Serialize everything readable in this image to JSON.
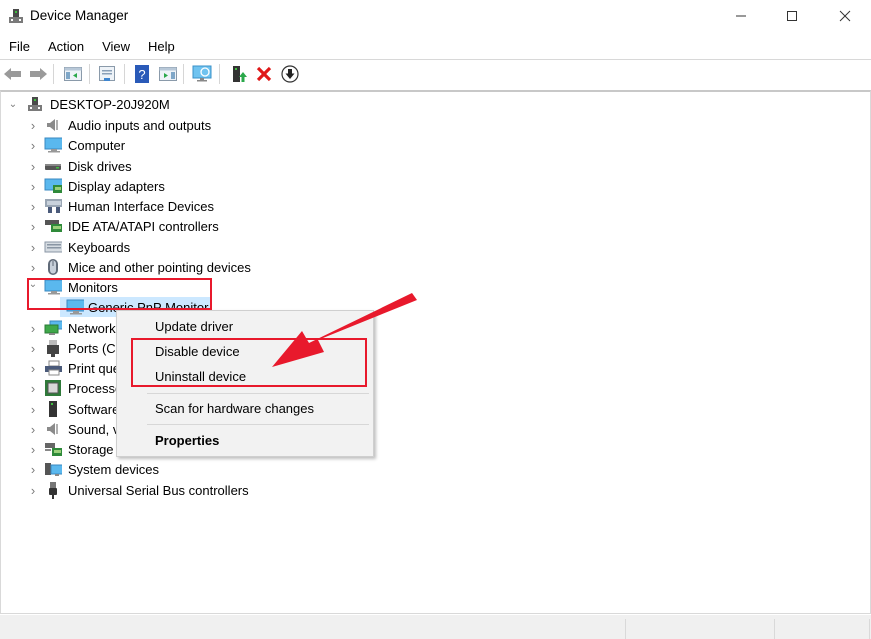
{
  "window": {
    "title": "Device Manager",
    "controls": {
      "minimize": "minimize",
      "maximize": "maximize",
      "close": "close"
    }
  },
  "menubar": {
    "items": [
      "File",
      "Action",
      "View",
      "Help"
    ]
  },
  "toolbar": {
    "buttons": [
      {
        "name": "back",
        "icon": "back-arrow-icon"
      },
      {
        "name": "forward",
        "icon": "forward-arrow-icon"
      },
      {
        "name": "show-hide-console-tree",
        "icon": "console-tree-icon"
      },
      {
        "name": "properties",
        "icon": "properties-icon"
      },
      {
        "name": "help",
        "icon": "help-icon"
      },
      {
        "name": "show-hide-action-pane",
        "icon": "action-pane-icon"
      },
      {
        "name": "scan-hardware",
        "icon": "scan-monitor-icon"
      },
      {
        "name": "update-driver",
        "icon": "update-driver-icon"
      },
      {
        "name": "uninstall",
        "icon": "red-x-icon"
      },
      {
        "name": "disable",
        "icon": "down-arrow-circle-icon"
      }
    ]
  },
  "tree": {
    "root": "DESKTOP-20J920M",
    "categories": [
      {
        "label": "Audio inputs and outputs",
        "icon": "speaker-icon",
        "expanded": false
      },
      {
        "label": "Computer",
        "icon": "computer-icon",
        "expanded": false
      },
      {
        "label": "Disk drives",
        "icon": "disk-drive-icon",
        "expanded": false
      },
      {
        "label": "Display adapters",
        "icon": "display-adapter-icon",
        "expanded": false
      },
      {
        "label": "Human Interface Devices",
        "icon": "hid-icon",
        "expanded": false
      },
      {
        "label": "IDE ATA/ATAPI controllers",
        "icon": "ide-controller-icon",
        "expanded": false
      },
      {
        "label": "Keyboards",
        "icon": "keyboard-icon",
        "expanded": false
      },
      {
        "label": "Mice and other pointing devices",
        "icon": "mouse-icon",
        "expanded": false
      },
      {
        "label": "Monitors",
        "icon": "monitor-icon",
        "expanded": true
      },
      {
        "label": "Generic PnP Monitor",
        "icon": "monitor-icon",
        "child": true,
        "selected": true
      },
      {
        "label": "Network adapters",
        "visible_text": "Network",
        "icon": "network-icon",
        "expanded": false
      },
      {
        "label": "Ports (COM & LPT)",
        "visible_text": "Ports (C",
        "icon": "port-icon",
        "expanded": false
      },
      {
        "label": "Print queues",
        "visible_text": "Print qu",
        "icon": "printer-icon",
        "expanded": false
      },
      {
        "label": "Processors",
        "visible_text": "Processo",
        "icon": "processor-icon",
        "expanded": false
      },
      {
        "label": "Software devices",
        "visible_text": "Software",
        "icon": "software-device-icon",
        "expanded": false
      },
      {
        "label": "Sound, video and game controllers",
        "visible_text": "Sound, v",
        "icon": "sound-icon",
        "expanded": false
      },
      {
        "label": "Storage controllers",
        "visible_text": "Storage",
        "icon": "storage-controller-icon",
        "expanded": false
      },
      {
        "label": "System devices",
        "icon": "system-devices-icon",
        "expanded": false
      },
      {
        "label": "Universal Serial Bus controllers",
        "icon": "usb-icon",
        "expanded": false
      }
    ]
  },
  "context_menu": {
    "items": [
      "Update driver",
      "Disable device",
      "Uninstall device",
      "Scan for hardware changes",
      "Properties"
    ]
  },
  "annotations": {
    "color": "#e8192c",
    "highlights": [
      "Monitors",
      "Disable device / Uninstall device"
    ]
  }
}
